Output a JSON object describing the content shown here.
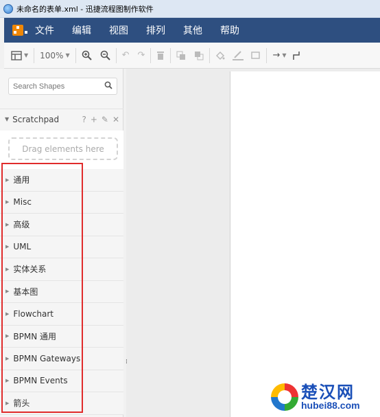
{
  "window": {
    "title": "未命名的表单.xml - 迅捷流程图制作软件"
  },
  "menu": [
    "文件",
    "编辑",
    "视图",
    "排列",
    "其他",
    "帮助"
  ],
  "toolbar": {
    "zoom": "100%"
  },
  "sidebar": {
    "search_placeholder": "Search Shapes",
    "scratchpad": {
      "label": "Scratchpad",
      "dropzone": "Drag elements here"
    },
    "categories": [
      "通用",
      "Misc",
      "高级",
      "UML",
      "实体关系",
      "基本图",
      "Flowchart",
      "BPMN 通用",
      "BPMN Gateways",
      "BPMN Events",
      "箭头"
    ]
  },
  "watermark": {
    "brand_cn": "楚汉网",
    "brand_en": "hubei88.com"
  },
  "colors": {
    "menubar": "#2e4f80",
    "highlight": "#e02b2b",
    "logo": "#f08705"
  }
}
